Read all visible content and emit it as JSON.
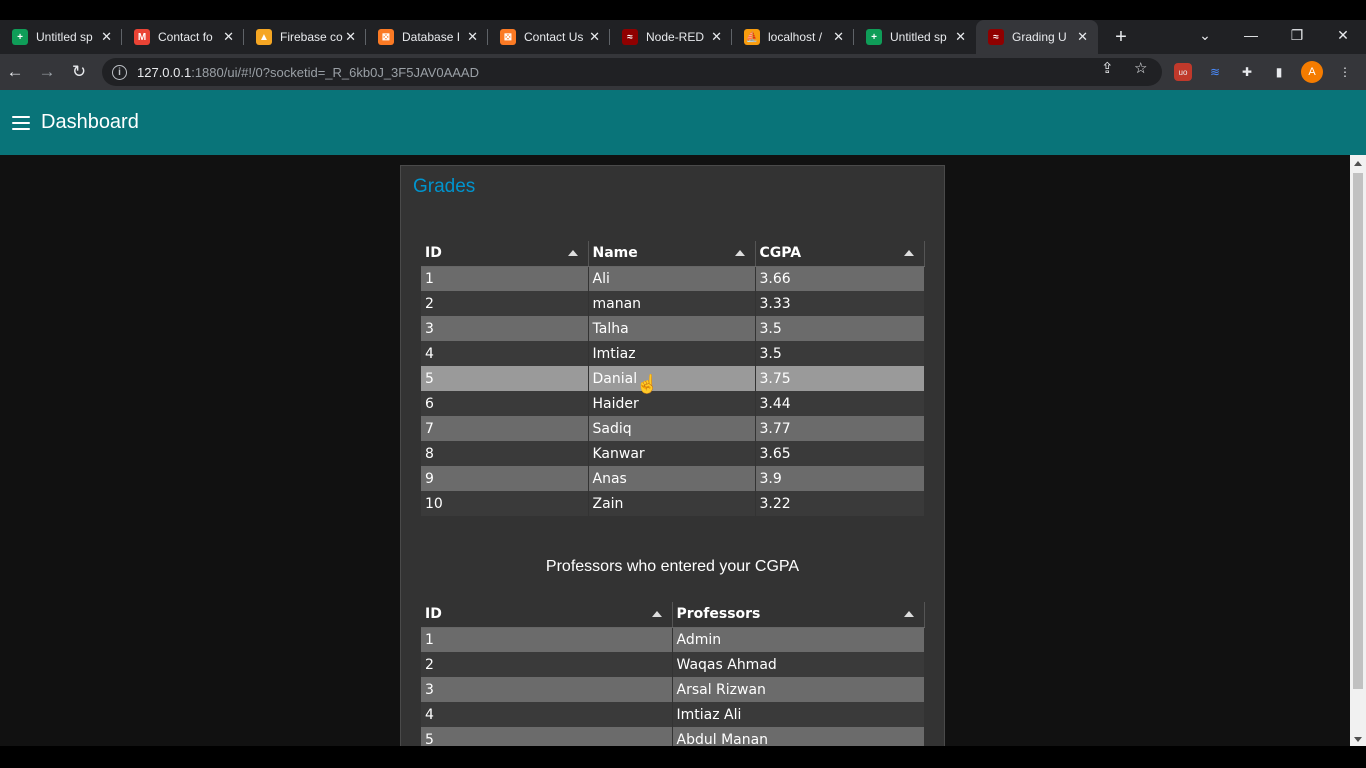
{
  "browser": {
    "tabs": [
      {
        "label": "Untitled sp",
        "icon": "sheets-icon",
        "color": "#0f9d58",
        "glyph": "+"
      },
      {
        "label": "Contact fo",
        "icon": "gmail-icon",
        "color": "#ea4335",
        "glyph": "M"
      },
      {
        "label": "Firebase co",
        "icon": "firebase-icon",
        "color": "#f5a623",
        "glyph": "▲"
      },
      {
        "label": "Database I",
        "icon": "xampp-icon",
        "color": "#fb7a24",
        "glyph": "⊠"
      },
      {
        "label": "Contact Us",
        "icon": "xampp-icon",
        "color": "#fb7a24",
        "glyph": "⊠"
      },
      {
        "label": "Node-RED",
        "icon": "node-red-icon",
        "color": "#8f0000",
        "glyph": "≈"
      },
      {
        "label": "localhost /",
        "icon": "phpmyadmin-icon",
        "color": "#f89c0e",
        "glyph": "⛵"
      },
      {
        "label": "Untitled sp",
        "icon": "sheets-icon",
        "color": "#0f9d58",
        "glyph": "+"
      },
      {
        "label": "Grading U",
        "icon": "node-red-icon",
        "color": "#8f0000",
        "glyph": "≈"
      }
    ],
    "url_host": "127.0.0.1",
    "url_path": ":1880/ui/#!/0?socketid=_R_6kb0J_3F5JAV0AAAD",
    "profile_initial": "A"
  },
  "app": {
    "title": "Dashboard"
  },
  "card": {
    "title": "Grades",
    "grades_headers": [
      "ID",
      "Name",
      "CGPA"
    ],
    "grades_rows": [
      [
        "1",
        "Ali",
        "3.66"
      ],
      [
        "2",
        "manan",
        "3.33"
      ],
      [
        "3",
        "Talha",
        "3.5"
      ],
      [
        "4",
        "Imtiaz",
        "3.5"
      ],
      [
        "5",
        "Danial",
        "3.75"
      ],
      [
        "6",
        "Haider",
        "3.44"
      ],
      [
        "7",
        "Sadiq",
        "3.77"
      ],
      [
        "8",
        "Kanwar",
        "3.65"
      ],
      [
        "9",
        "Anas",
        "3.9"
      ],
      [
        "10",
        "Zain",
        "3.22"
      ]
    ],
    "subtitle": "Professors who entered your CGPA",
    "prof_headers": [
      "ID",
      "Professors"
    ],
    "prof_rows": [
      [
        "1",
        "Admin"
      ],
      [
        "2",
        "Waqas Ahmad"
      ],
      [
        "3",
        "Arsal Rizwan"
      ],
      [
        "4",
        "Imtiaz Ali"
      ],
      [
        "5",
        "Abdul Manan"
      ]
    ]
  },
  "colors": {
    "appbar": "#097479",
    "title_accent": "#0094ce"
  }
}
